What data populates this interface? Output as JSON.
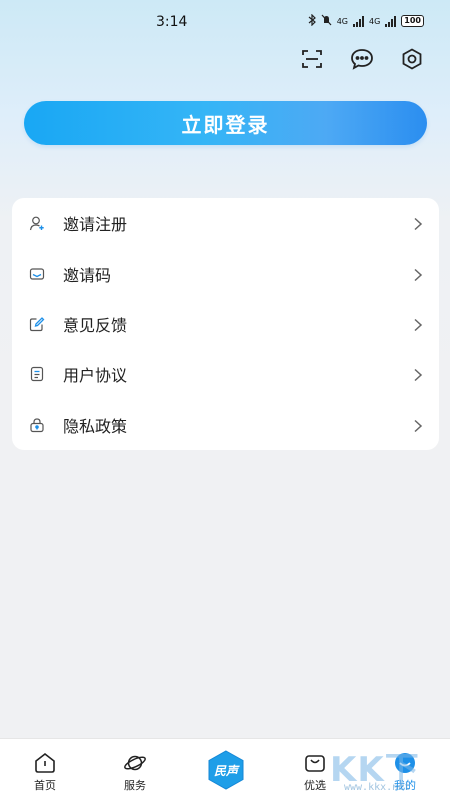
{
  "status_bar": {
    "time": "3:14",
    "network_label_1": "4G",
    "network_label_2": "4G",
    "battery": "100"
  },
  "top_actions": {
    "icons": [
      "scan-icon",
      "message-icon",
      "settings-icon"
    ]
  },
  "login": {
    "label": "立即登录"
  },
  "menu": {
    "items": [
      {
        "label": "邀请注册",
        "icon": "user-add-icon"
      },
      {
        "label": "邀请码",
        "icon": "mail-icon"
      },
      {
        "label": "意见反馈",
        "icon": "edit-icon"
      },
      {
        "label": "用户协议",
        "icon": "document-icon"
      },
      {
        "label": "隐私政策",
        "icon": "lock-icon"
      }
    ]
  },
  "tab_bar": {
    "tabs": [
      {
        "label": "首页",
        "icon": "home-icon"
      },
      {
        "label": "服务",
        "icon": "planet-icon"
      },
      {
        "label": "优选",
        "icon": "bag-icon"
      },
      {
        "label": "我的",
        "icon": "profile-icon",
        "active": true
      }
    ],
    "center_logo_text": "民声"
  },
  "watermark": {
    "text": "KK下载",
    "url": "www.kkx.net"
  },
  "colors": {
    "accent": "#1e90e8",
    "login_gradient_start": "#19a7f4",
    "login_gradient_end": "#2b8ef0"
  }
}
